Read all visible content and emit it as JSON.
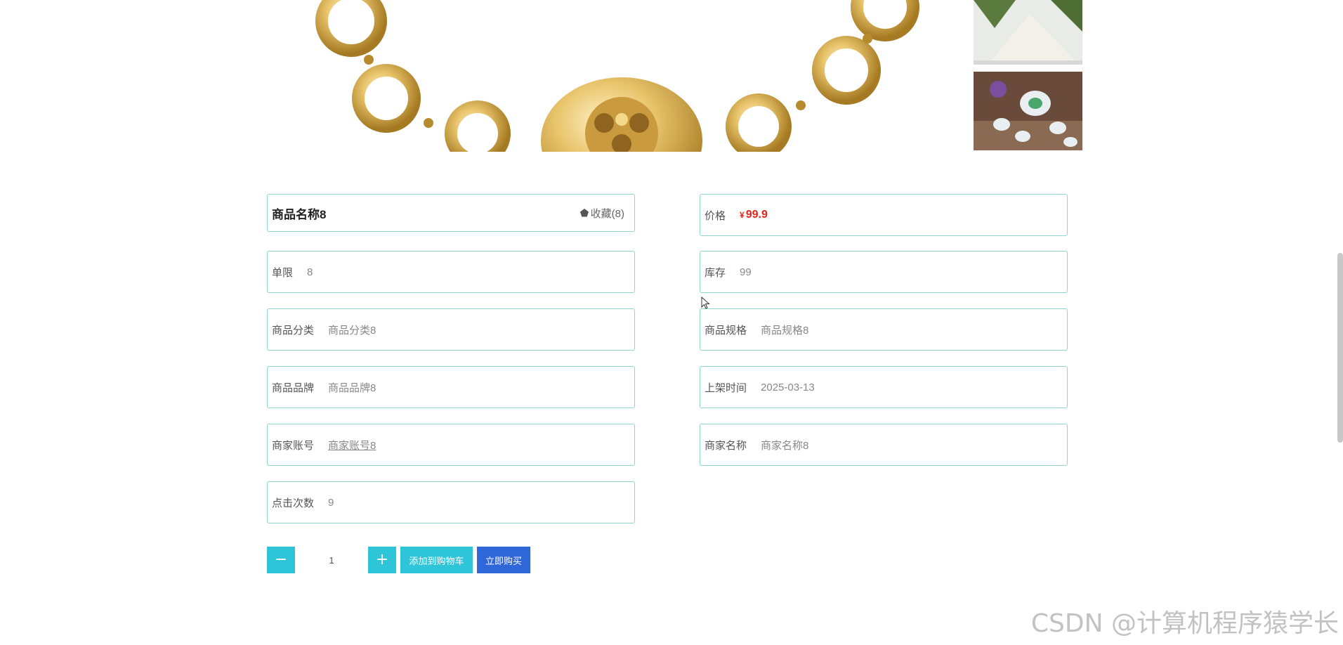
{
  "product": {
    "name": "商品名称8",
    "favorite_label": "收藏(8)",
    "price_label": "价格",
    "price_currency": "¥",
    "price_value": "99.9"
  },
  "fields": {
    "limit": {
      "label": "单限",
      "value": "8"
    },
    "stock": {
      "label": "库存",
      "value": "99"
    },
    "category": {
      "label": "商品分类",
      "value": "商品分类8"
    },
    "spec": {
      "label": "商品规格",
      "value": "商品规格8"
    },
    "brand": {
      "label": "商品品牌",
      "value": "商品品牌8"
    },
    "listed": {
      "label": "上架时间",
      "value": "2025-03-13"
    },
    "merchant_account": {
      "label": "商家账号",
      "value": "商家账号8"
    },
    "merchant_name": {
      "label": "商家名称",
      "value": "商家名称8"
    },
    "clicks": {
      "label": "点击次数",
      "value": "9"
    }
  },
  "purchase": {
    "minus": "−",
    "plus": "+",
    "quantity": "1",
    "add_to_cart": "添加到购物车",
    "buy_now": "立即购买"
  },
  "watermark": "CSDN @计算机程序猿学长",
  "colors": {
    "accent": "#2ec5d9",
    "buy": "#2f66d8",
    "price": "#e2231a",
    "card_border": "#8fd6cf"
  }
}
